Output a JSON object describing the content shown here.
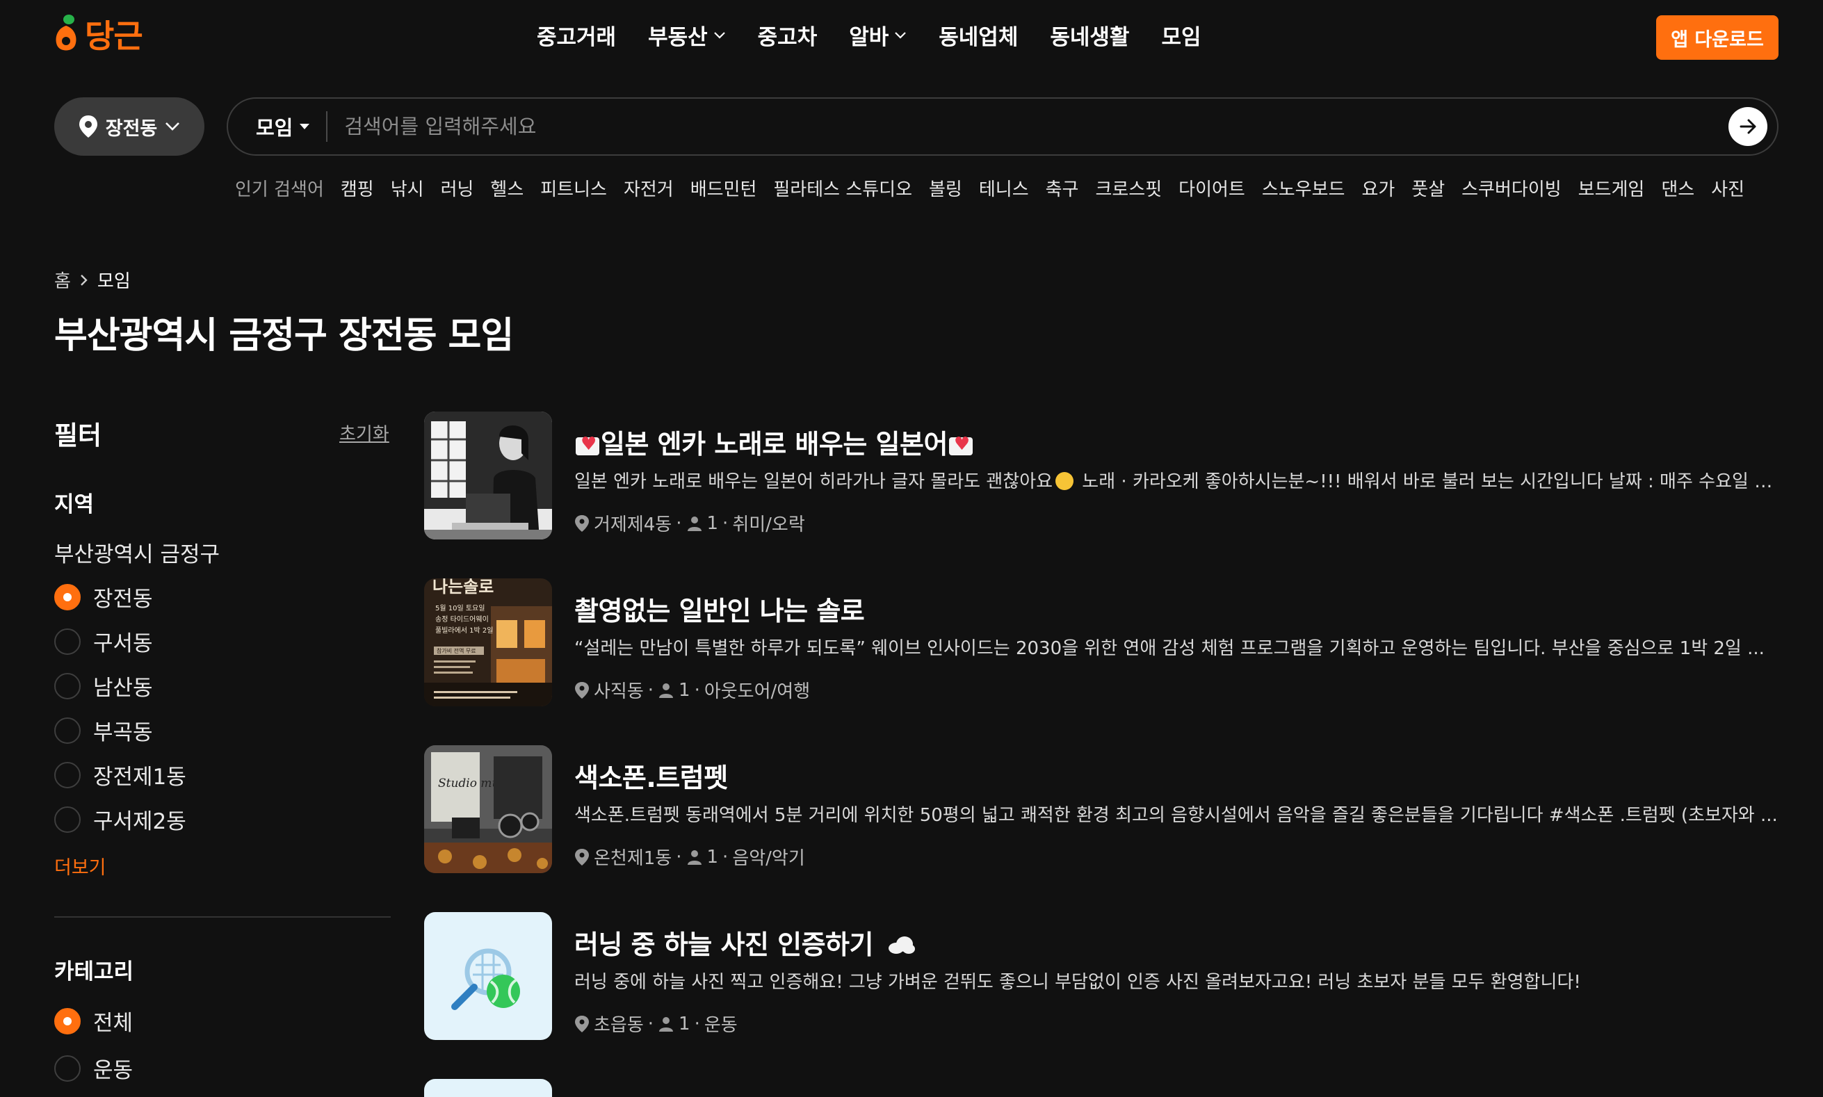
{
  "brand": {
    "name": "당근",
    "color": "#ff6f0f"
  },
  "nav": [
    {
      "label": "중고거래",
      "dropdown": false
    },
    {
      "label": "부동산",
      "dropdown": true
    },
    {
      "label": "중고차",
      "dropdown": false
    },
    {
      "label": "알바",
      "dropdown": true
    },
    {
      "label": "동네업체",
      "dropdown": false
    },
    {
      "label": "동네생활",
      "dropdown": false
    },
    {
      "label": "모임",
      "dropdown": false
    }
  ],
  "header": {
    "download_label": "앱 다운로드"
  },
  "location": {
    "label": "장전동"
  },
  "search": {
    "category": "모임",
    "placeholder": "검색어를 입력해주세요"
  },
  "popular": {
    "label": "인기 검색어",
    "keywords": [
      "캠핑",
      "낚시",
      "러닝",
      "헬스",
      "피트니스",
      "자전거",
      "배드민턴",
      "필라테스 스튜디오",
      "볼링",
      "테니스",
      "축구",
      "크로스핏",
      "다이어트",
      "스노우보드",
      "요가",
      "풋살",
      "스쿠버다이빙",
      "보드게임",
      "댄스",
      "사진"
    ]
  },
  "breadcrumb": {
    "home": "홈",
    "current": "모임"
  },
  "page": {
    "title": "부산광역시 금정구 장전동 모임"
  },
  "filter": {
    "title": "필터",
    "reset_label": "초기화",
    "region": {
      "title": "지역",
      "city": "부산광역시 금정구",
      "options": [
        {
          "label": "장전동",
          "selected": true
        },
        {
          "label": "구서동",
          "selected": false
        },
        {
          "label": "남산동",
          "selected": false
        },
        {
          "label": "부곡동",
          "selected": false
        },
        {
          "label": "장전제1동",
          "selected": false
        },
        {
          "label": "구서제2동",
          "selected": false
        }
      ],
      "more_label": "더보기"
    },
    "category": {
      "title": "카테고리",
      "options": [
        {
          "label": "전체",
          "selected": true
        },
        {
          "label": "운동",
          "selected": false
        }
      ]
    }
  },
  "listings": [
    {
      "title": "일본 엔카 노래로 배우는 일본어",
      "desc_a": "일본 엔카 노래로 배우는 일본어 히라가나 글자 몰라도 괜찮아요",
      "desc_b": " 노래 · 카라오케 좋아하시는분~!!! 배워서 바로 불러 보는 시간입니다 날짜 : 매주 수요일 2...",
      "location": "거제제4동",
      "members": "1",
      "category": "취미/오락"
    },
    {
      "title": "촬영없는 일반인 나는 솔로",
      "desc_a": "“설레는 만남이 특별한 하루가 되도록” 웨이브 인사이드는 2030을 위한 연애 감성 체험 프로그램을 기획하고 운영하는 팀입니다. 부산을 중심으로 1박 2일 ...",
      "location": "사직동",
      "members": "1",
      "category": "아웃도어/여행",
      "thumb_text": {
        "heading": "나는솔로",
        "line1": "5월 10일 토요일",
        "line2": "송정 타이드어웨이",
        "line3": "풀빌라에서 1박 2일",
        "badge": "참가비 전액 무료"
      }
    },
    {
      "title": "색소폰.트럼펫",
      "desc_a": "색소폰.트럼펫 동래역에서 5분 거리에 위치한 50평의 넓고 쾌적한 환경 최고의 음향시설에서 음악을 즐길 좋은분들을 기다립니다 #색소폰 .트럼펫 (초보자와 ...",
      "location": "온천제1동",
      "members": "1",
      "category": "음악/악기",
      "thumb_text": {
        "sign": "Studio muse"
      }
    },
    {
      "title": "러닝 중 하늘 사진 인증하기",
      "desc_a": "러닝 중에 하늘 사진 찍고 인증해요! 그냥 가벼운 걷뛰도 좋으니 부담없이 인증 사진 올려보자고요! 러닝 초보자 분들 모두 환영합니다!",
      "location": "초읍동",
      "members": "1",
      "category": "운동"
    }
  ]
}
